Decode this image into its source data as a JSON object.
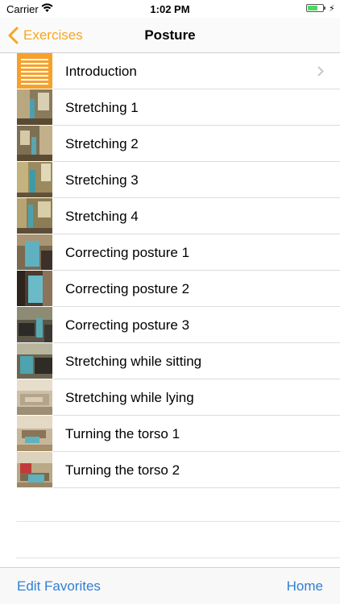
{
  "status": {
    "carrier": "Carrier",
    "time": "1:02 PM"
  },
  "nav": {
    "back_label": "Exercises",
    "title": "Posture",
    "accent": "#F6A623"
  },
  "rows": [
    {
      "label": "Introduction",
      "thumb": "intro-list-icon",
      "has_chevron": true
    },
    {
      "label": "Stretching 1",
      "thumb": "photo"
    },
    {
      "label": "Stretching 2",
      "thumb": "photo"
    },
    {
      "label": "Stretching 3",
      "thumb": "photo"
    },
    {
      "label": "Stretching 4",
      "thumb": "photo"
    },
    {
      "label": "Correcting posture 1",
      "thumb": "photo"
    },
    {
      "label": "Correcting posture 2",
      "thumb": "photo"
    },
    {
      "label": "Correcting posture 3",
      "thumb": "photo"
    },
    {
      "label": "Stretching while sitting",
      "thumb": "photo"
    },
    {
      "label": "Stretching while lying",
      "thumb": "photo"
    },
    {
      "label": "Turning the torso 1",
      "thumb": "photo"
    },
    {
      "label": "Turning the torso 2",
      "thumb": "photo"
    }
  ],
  "toolbar": {
    "left_label": "Edit Favorites",
    "right_label": "Home",
    "tint": "#2F7FD3"
  }
}
